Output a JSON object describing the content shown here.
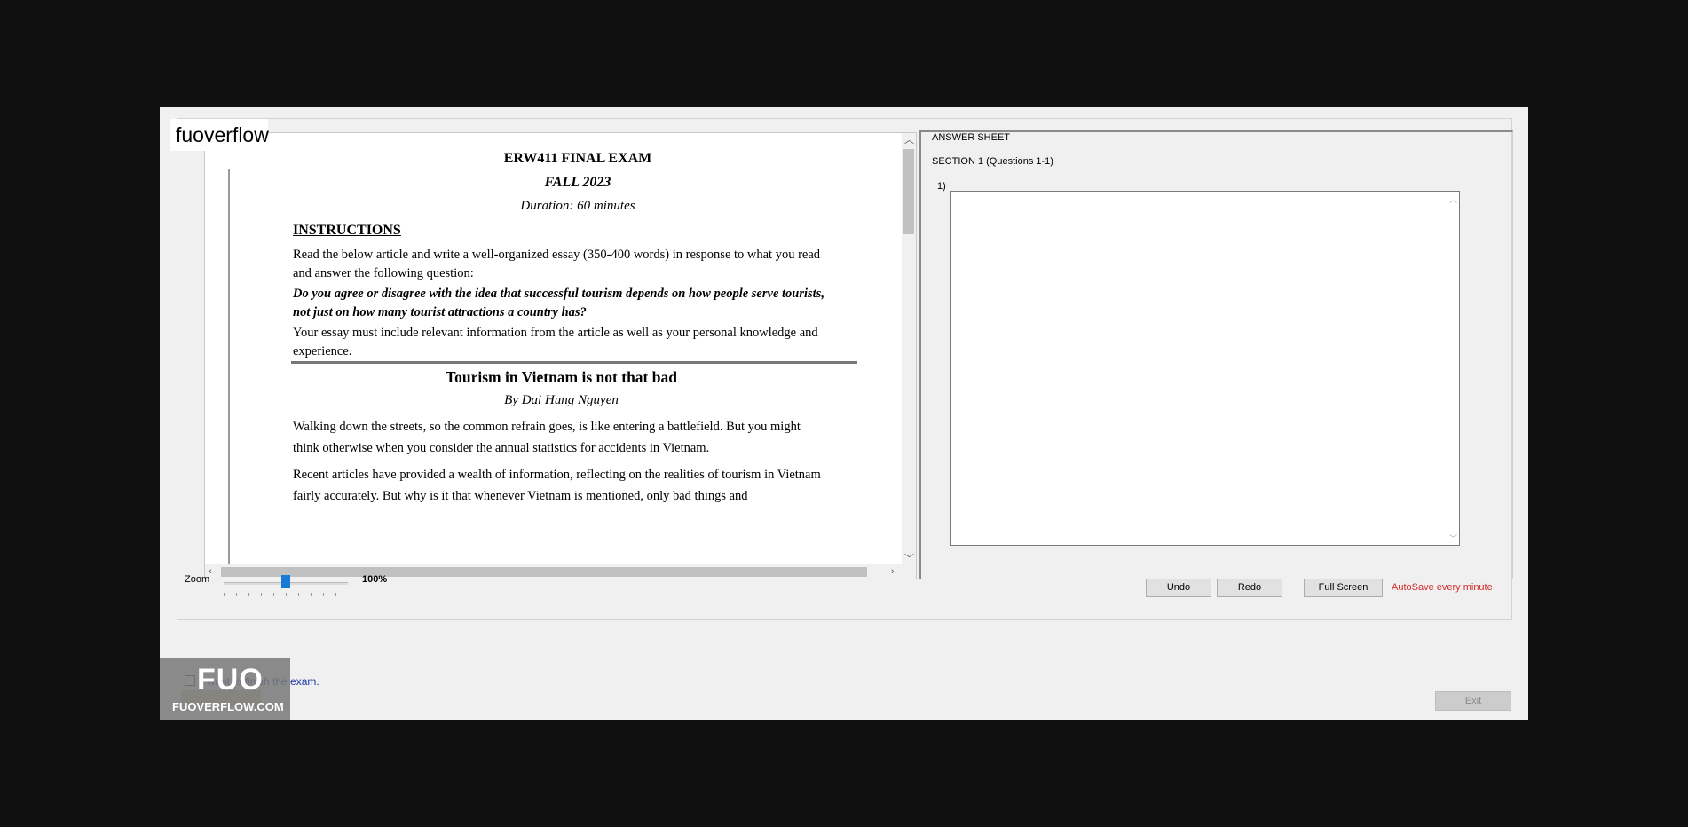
{
  "brand": {
    "title": "fuoverflow"
  },
  "document": {
    "title": "ERW411 FINAL EXAM",
    "term": "FALL 2023",
    "duration": "Duration: 60 minutes",
    "instructions_heading": "INSTRUCTIONS",
    "instructions_text": "Read the below article and write a well-organized essay (350-400 words) in response to what you read and answer the following question:",
    "question": "Do you agree or disagree with the idea that successful tourism depends on how people serve tourists, not just on how many tourist attractions a country has?",
    "requirement": "Your essay must include relevant information from the article as well as your personal knowledge and experience.",
    "article_title": "Tourism in Vietnam is not that bad",
    "byline": "By Dai Hung Nguyen",
    "paragraph_1": "Walking down the streets, so the common refrain goes, is like entering a battlefield. But you might think otherwise when you consider the annual statistics for accidents in Vietnam.",
    "paragraph_2": "Recent articles have provided a wealth of information, reflecting on the realities of tourism in Vietnam fairly accurately. But why is it that whenever Vietnam is mentioned, only bad things and"
  },
  "answer_sheet": {
    "heading": "ANSWER SHEET",
    "section": "SECTION 1 (Questions 1-1)",
    "question_number": "1)",
    "answer_value": ""
  },
  "zoom": {
    "label": "Zoom",
    "value": "100%",
    "level": 0.5
  },
  "toolbar": {
    "undo_label": "Undo",
    "redo_label": "Redo",
    "fullscreen_label": "Full Screen",
    "autosave_text": "AutoSave every minute"
  },
  "finish": {
    "label": "I want to finish the exam.",
    "checked": false
  },
  "logo": {
    "mark": "FUO",
    "text": "FUOVERFLOW.COM"
  },
  "exit": {
    "label": "Exit"
  },
  "colors": {
    "accent": "#1979d6",
    "autosave": "#d22c2c",
    "finish_label": "#1d3aa8"
  }
}
